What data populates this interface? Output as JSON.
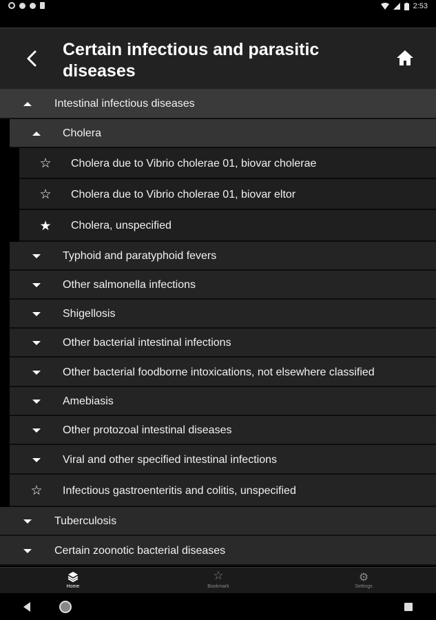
{
  "status_bar": {
    "time": "2:53"
  },
  "header": {
    "title": "Certain infectious and parasitic diseases",
    "back_icon": "back-arrow-icon",
    "home_icon": "home-icon"
  },
  "list": {
    "items": [
      {
        "level": 1,
        "state": "expanded",
        "label": "Intestinal infectious diseases"
      },
      {
        "level": 2,
        "state": "expanded",
        "label": "Cholera"
      },
      {
        "level": 3,
        "state": "star-outline",
        "label": "Cholera due to Vibrio cholerae 01, biovar cholerae"
      },
      {
        "level": 3,
        "state": "star-outline",
        "label": "Cholera due to Vibrio cholerae 01, biovar eltor"
      },
      {
        "level": 3,
        "state": "star-filled",
        "label": "Cholera, unspecified"
      },
      {
        "level": 2,
        "state": "collapsed",
        "label": "Typhoid and paratyphoid fevers"
      },
      {
        "level": 2,
        "state": "collapsed",
        "label": "Other salmonella infections"
      },
      {
        "level": 2,
        "state": "collapsed",
        "label": "Shigellosis"
      },
      {
        "level": 2,
        "state": "collapsed",
        "label": "Other bacterial intestinal infections"
      },
      {
        "level": 2,
        "state": "collapsed",
        "label": "Other bacterial foodborne intoxications, not elsewhere classified"
      },
      {
        "level": 2,
        "state": "collapsed",
        "label": "Amebiasis"
      },
      {
        "level": 2,
        "state": "collapsed",
        "label": "Other protozoal intestinal diseases"
      },
      {
        "level": 2,
        "state": "collapsed",
        "label": "Viral and other specified intestinal infections"
      },
      {
        "level": 2,
        "state": "star-outline",
        "label": "Infectious gastroenteritis and colitis, unspecified"
      },
      {
        "level": 1,
        "state": "collapsed",
        "label": "Tuberculosis"
      },
      {
        "level": 1,
        "state": "collapsed",
        "label": "Certain zoonotic bacterial diseases"
      }
    ]
  },
  "bottom_nav": {
    "home_label": "Home",
    "bookmark_label": "Bookmark",
    "settings_label": "Settings"
  }
}
